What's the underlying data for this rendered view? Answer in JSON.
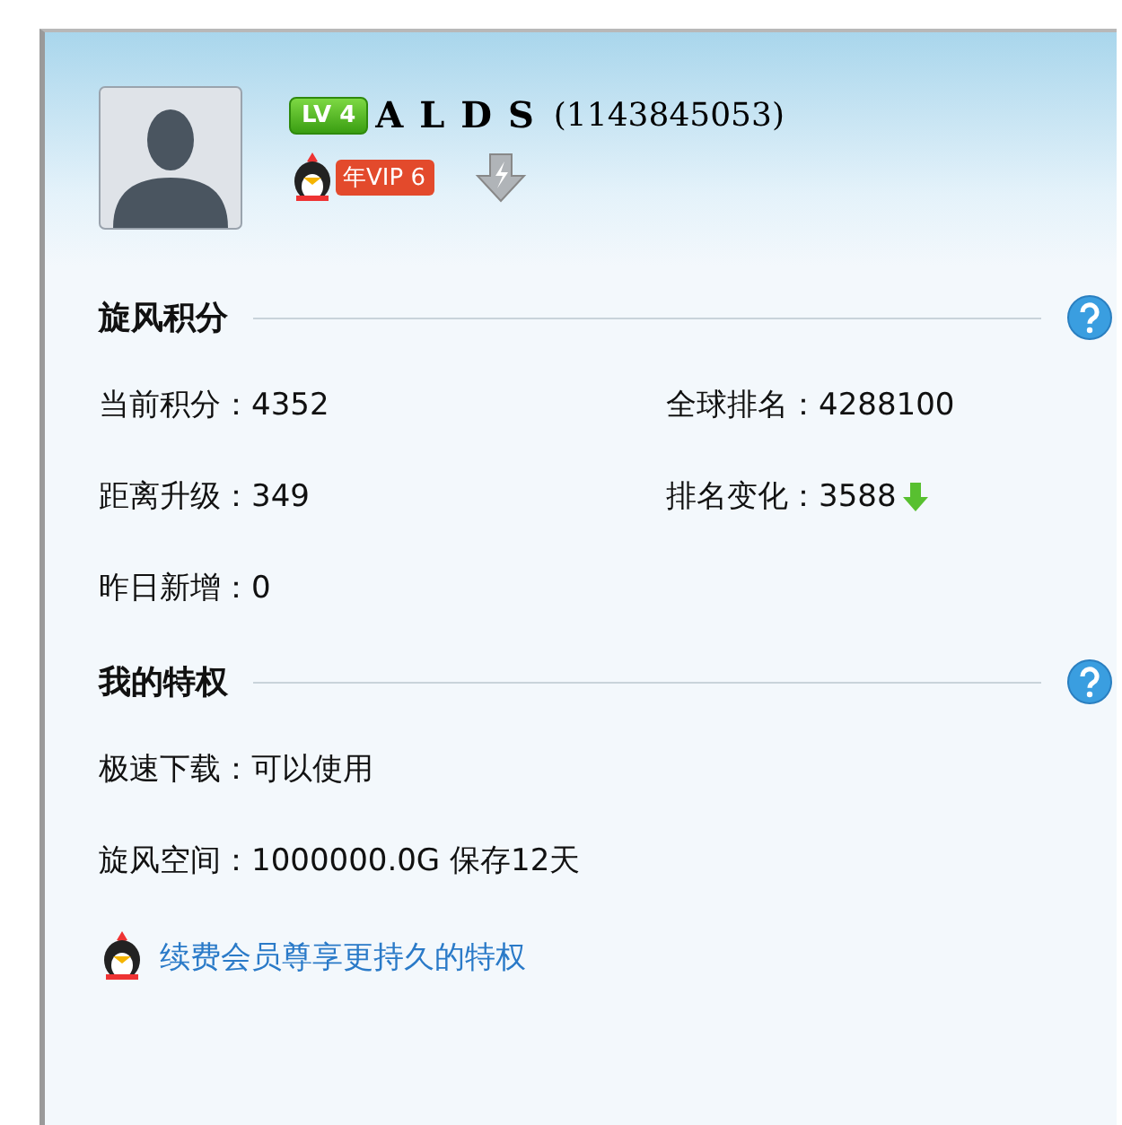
{
  "profile": {
    "level_badge": "LV 4",
    "name": "A L D S",
    "qq_number": "(1143845053)",
    "vip_badge": "年VIP 6"
  },
  "sections": [
    {
      "title": "旋风积分",
      "kind": "grid",
      "items": [
        {
          "text": "当前积分：4352",
          "kind": "plain"
        },
        {
          "text": "全球排名：4288100",
          "kind": "plain"
        },
        {
          "text": "距离升级：349",
          "kind": "plain"
        },
        {
          "text": "排名变化：3588",
          "kind": "falling"
        },
        {
          "text": "昨日新增：0",
          "kind": "plain"
        }
      ]
    },
    {
      "title": "我的特权",
      "kind": "list",
      "items": [
        {
          "text": "极速下载：可以使用",
          "kind": "plain"
        },
        {
          "text": "旋风空间：1000000.0G 保存12天",
          "kind": "plain"
        }
      ]
    }
  ],
  "renew_link": "续费会员尊享更持久的特权"
}
